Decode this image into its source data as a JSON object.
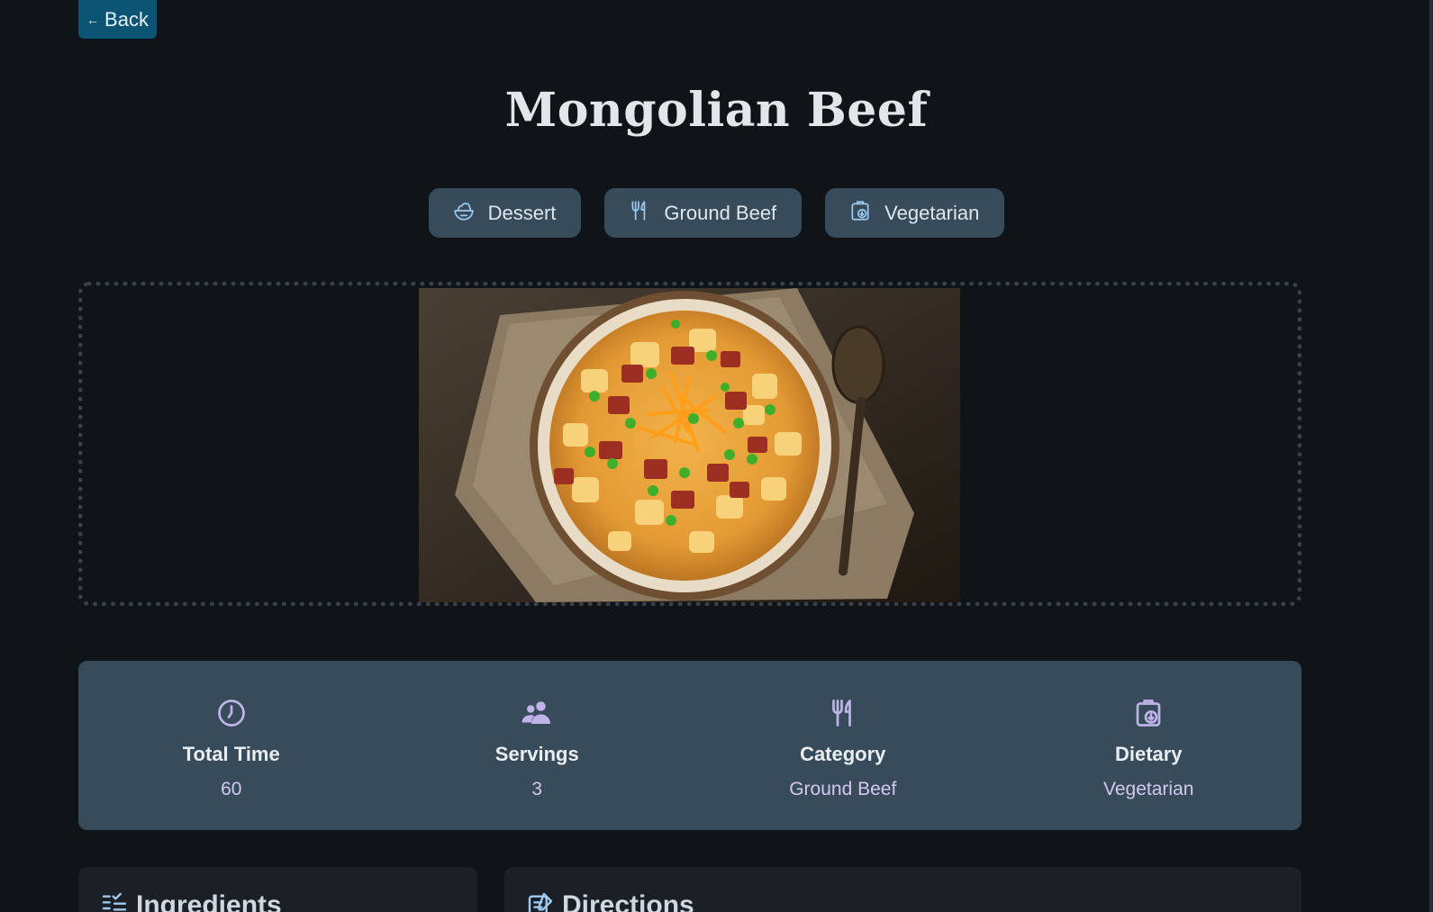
{
  "nav": {
    "back_label": "Back"
  },
  "recipe": {
    "title": "Mongolian Beef",
    "tags": [
      {
        "label": "Dessert",
        "icon": "bowl-icon"
      },
      {
        "label": "Ground Beef",
        "icon": "fork-knife-icon"
      },
      {
        "label": "Vegetarian",
        "icon": "clipboard-leaf-icon"
      }
    ],
    "image_alt": "Bowl of loaded potato soup topped with bacon, cheddar and green onions"
  },
  "stats": [
    {
      "label": "Total Time",
      "value": "60",
      "icon": "clock-icon"
    },
    {
      "label": "Servings",
      "value": "3",
      "icon": "people-icon"
    },
    {
      "label": "Category",
      "value": "Ground Beef",
      "icon": "fork-knife-icon"
    },
    {
      "label": "Dietary",
      "value": "Vegetarian",
      "icon": "clipboard-leaf-icon"
    }
  ],
  "sections": {
    "ingredients_title": "Ingredients",
    "directions_title": "Directions"
  },
  "colors": {
    "background": "#0f1419",
    "accent_button": "#0b5474",
    "tag_bg": "#384b5a",
    "stat_value": "#d3c8ee",
    "icon_color": "#bfb3e8"
  }
}
